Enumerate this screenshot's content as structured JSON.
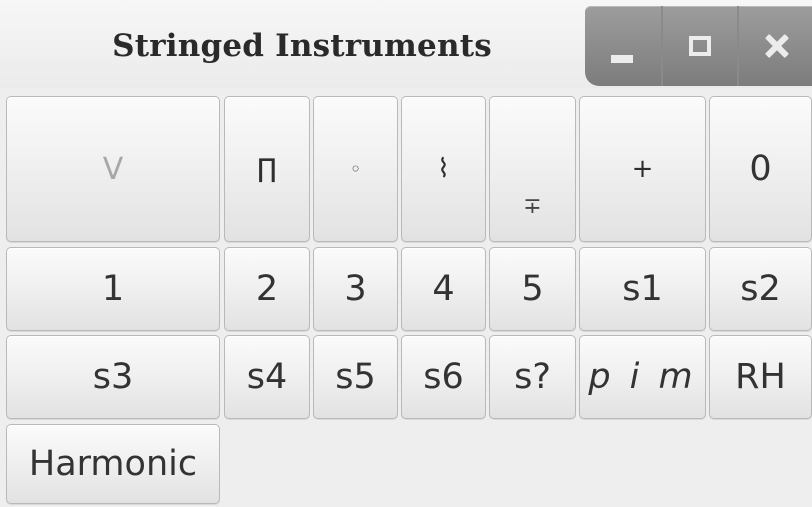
{
  "window": {
    "title": "Stringed Instruments",
    "controls": {
      "minimize": "minimize",
      "maximize": "maximize",
      "close": "close"
    }
  },
  "rows": [
    [
      "V",
      "∏",
      "◦",
      "⌇",
      "∓",
      "+",
      "0"
    ],
    [
      "1",
      "2",
      "3",
      "4",
      "5",
      "s1",
      "s2"
    ],
    [
      "s3",
      "s4",
      "s5",
      "s6",
      "s?",
      "p i m",
      "RH"
    ],
    [
      "Harmonic"
    ]
  ],
  "symbols": {
    "up_bow": "V",
    "down_bow": "∏",
    "harmonic_circle": "◦",
    "arpeggio": "⌇",
    "stopped": "∓",
    "plus": "+",
    "open_string": "0"
  }
}
